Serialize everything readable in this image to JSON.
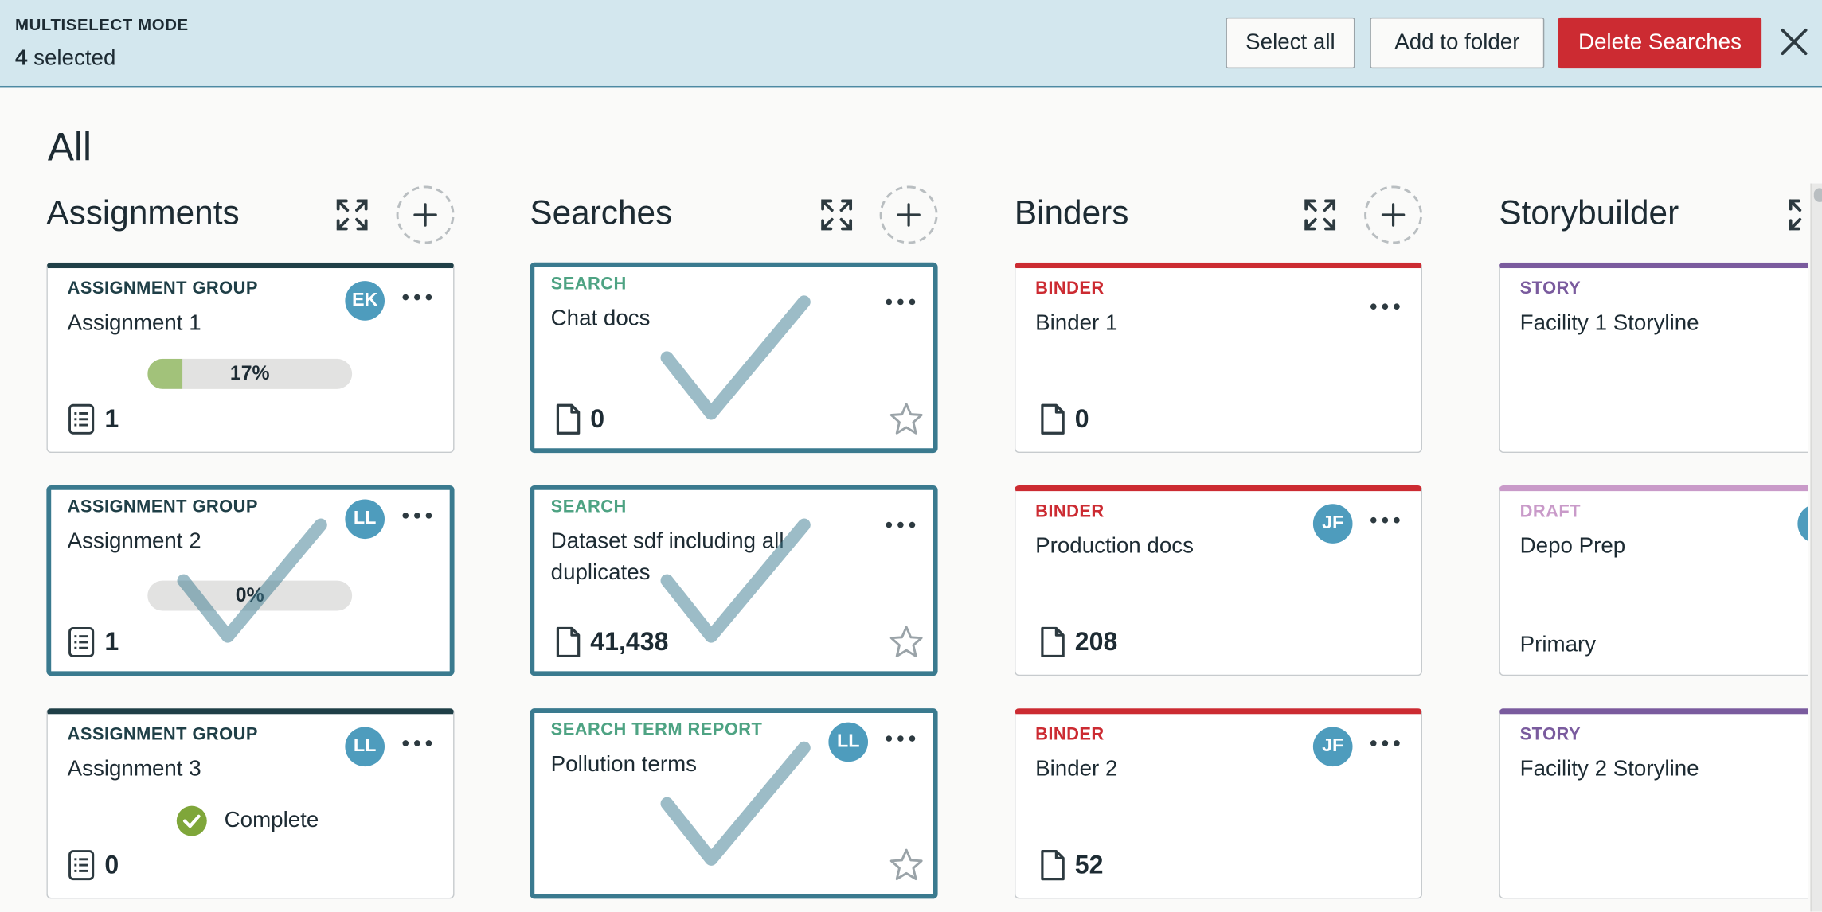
{
  "banner": {
    "mode_label": "MULTISELECT MODE",
    "selected_count": "4",
    "selected_suffix": " selected",
    "select_all": "Select all",
    "add_to_folder": "Add to folder",
    "delete_searches": "Delete Searches"
  },
  "page_title": "All",
  "colors": {
    "accent_teal": "#3a7a8f",
    "danger_red": "#cc2b32",
    "assignment_green_dark": "#1f3f47",
    "search_green": "#4ea383",
    "binder_red": "#cc2b32",
    "story_purple": "#7a5b9e",
    "draft_purple": "#c99ac9",
    "avatar_blue": "#4e9cbd",
    "progress_green": "#a2c27a",
    "complete_green": "#7fa63a"
  },
  "columns": [
    {
      "title": "Assignments",
      "cards": [
        {
          "type": "ASSIGNMENT GROUP",
          "name": "Assignment 1",
          "avatar": "EK",
          "progress": 17,
          "progress_label": "17%",
          "count": "1",
          "selected": false
        },
        {
          "type": "ASSIGNMENT GROUP",
          "name": "Assignment 2",
          "avatar": "LL",
          "progress": 0,
          "progress_label": "0%",
          "count": "1",
          "selected": true
        },
        {
          "type": "ASSIGNMENT GROUP",
          "name": "Assignment 3",
          "avatar": "LL",
          "status": "Complete",
          "count": "0",
          "selected": false
        }
      ]
    },
    {
      "title": "Searches",
      "cards": [
        {
          "type": "SEARCH",
          "name": "Chat docs",
          "count": "0",
          "selected": true
        },
        {
          "type": "SEARCH",
          "name": "Dataset sdf including all duplicates",
          "count": "41,438",
          "selected": true
        },
        {
          "type": "SEARCH TERM REPORT",
          "name": "Pollution terms",
          "avatar": "LL",
          "selected": true
        }
      ]
    },
    {
      "title": "Binders",
      "cards": [
        {
          "type": "BINDER",
          "name": "Binder 1",
          "count": "0",
          "selected": false
        },
        {
          "type": "BINDER",
          "name": "Production docs",
          "avatar": "JF",
          "count": "208",
          "selected": false
        },
        {
          "type": "BINDER",
          "name": "Binder 2",
          "avatar": "JF",
          "count": "52",
          "selected": false
        }
      ]
    },
    {
      "title": "Storybuilder",
      "cards": [
        {
          "type": "STORY",
          "name": "Facility 1 Storyline",
          "selected": false
        },
        {
          "type": "DRAFT",
          "name": "Depo Prep",
          "sub": "Primary",
          "selected": false
        },
        {
          "type": "STORY",
          "name": "Facility 2 Storyline",
          "selected": false
        }
      ]
    }
  ]
}
